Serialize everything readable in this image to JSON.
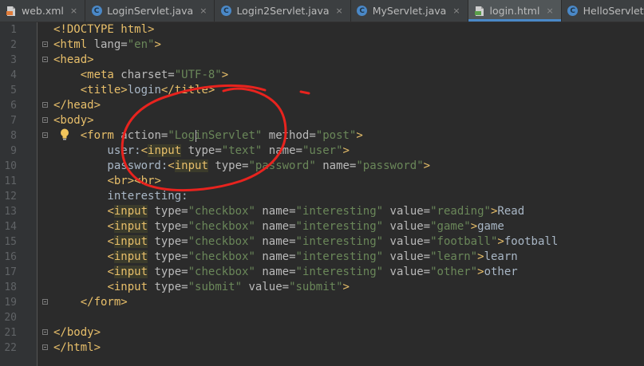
{
  "tabs": [
    {
      "label": "web.xml",
      "icon": "xml-file-icon",
      "active": false
    },
    {
      "label": "LoginServlet.java",
      "icon": "java-class-icon",
      "active": false
    },
    {
      "label": "Login2Servlet.java",
      "icon": "java-class-icon",
      "active": false
    },
    {
      "label": "MyServlet.java",
      "icon": "java-class-icon",
      "active": false
    },
    {
      "label": "login.html",
      "icon": "html-file-icon",
      "active": true
    },
    {
      "label": "HelloServlet.java",
      "icon": "java-class-icon",
      "active": false
    }
  ],
  "editor": {
    "line_numbers": [
      "1",
      "2",
      "3",
      "4",
      "5",
      "6",
      "7",
      "8",
      "9",
      "10",
      "11",
      "12",
      "13",
      "14",
      "15",
      "16",
      "17",
      "18",
      "19",
      "20",
      "21",
      "22"
    ],
    "lines": [
      [
        {
          "c": "t",
          "v": "<!DOCTYPE html>"
        }
      ],
      [
        {
          "c": "t",
          "v": "<html "
        },
        {
          "c": "a",
          "v": "lang="
        },
        {
          "c": "s",
          "v": "\"en\""
        },
        {
          "c": "t",
          "v": ">"
        }
      ],
      [
        {
          "c": "t",
          "v": "<head>"
        }
      ],
      [
        {
          "c": "p",
          "v": "    "
        },
        {
          "c": "t",
          "v": "<meta "
        },
        {
          "c": "a",
          "v": "charset="
        },
        {
          "c": "s",
          "v": "\"UTF-8\""
        },
        {
          "c": "t",
          "v": ">"
        }
      ],
      [
        {
          "c": "p",
          "v": "    "
        },
        {
          "c": "t",
          "v": "<title>"
        },
        {
          "c": "p",
          "v": "login"
        },
        {
          "c": "t",
          "v": "</title>"
        }
      ],
      [
        {
          "c": "t",
          "v": "</head>"
        }
      ],
      [
        {
          "c": "t",
          "v": "<body>"
        }
      ],
      [
        {
          "c": "p",
          "v": "    "
        },
        {
          "c": "t",
          "v": "<form "
        },
        {
          "c": "a",
          "v": "action="
        },
        {
          "c": "s",
          "v": "\"LoginServlet\""
        },
        {
          "c": "p",
          "v": " "
        },
        {
          "c": "a",
          "v": "method="
        },
        {
          "c": "s",
          "v": "\"post\""
        },
        {
          "c": "t",
          "v": ">"
        }
      ],
      [
        {
          "c": "p",
          "v": "        user:"
        },
        {
          "c": "t",
          "v": "<"
        },
        {
          "c": "th",
          "v": "input"
        },
        {
          "c": "t",
          "v": " "
        },
        {
          "c": "a",
          "v": "type="
        },
        {
          "c": "s",
          "v": "\"text\""
        },
        {
          "c": "p",
          "v": " "
        },
        {
          "c": "a",
          "v": "name="
        },
        {
          "c": "s",
          "v": "\"user\""
        },
        {
          "c": "t",
          "v": ">"
        }
      ],
      [
        {
          "c": "p",
          "v": "        password:"
        },
        {
          "c": "t",
          "v": "<"
        },
        {
          "c": "th",
          "v": "input"
        },
        {
          "c": "t",
          "v": " "
        },
        {
          "c": "a",
          "v": "type="
        },
        {
          "c": "s",
          "v": "\"password\""
        },
        {
          "c": "p",
          "v": " "
        },
        {
          "c": "a",
          "v": "name="
        },
        {
          "c": "s",
          "v": "\"password\""
        },
        {
          "c": "t",
          "v": ">"
        }
      ],
      [
        {
          "c": "p",
          "v": "        "
        },
        {
          "c": "t",
          "v": "<br><br>"
        }
      ],
      [
        {
          "c": "p",
          "v": "        interesting:"
        }
      ],
      [
        {
          "c": "p",
          "v": "        "
        },
        {
          "c": "t",
          "v": "<"
        },
        {
          "c": "th",
          "v": "input"
        },
        {
          "c": "t",
          "v": " "
        },
        {
          "c": "a",
          "v": "type="
        },
        {
          "c": "s",
          "v": "\"checkbox\""
        },
        {
          "c": "p",
          "v": " "
        },
        {
          "c": "a",
          "v": "name="
        },
        {
          "c": "s",
          "v": "\"interesting\""
        },
        {
          "c": "p",
          "v": " "
        },
        {
          "c": "a",
          "v": "value="
        },
        {
          "c": "s",
          "v": "\"reading\""
        },
        {
          "c": "t",
          "v": ">"
        },
        {
          "c": "p",
          "v": "Read"
        }
      ],
      [
        {
          "c": "p",
          "v": "        "
        },
        {
          "c": "t",
          "v": "<"
        },
        {
          "c": "th",
          "v": "input"
        },
        {
          "c": "t",
          "v": " "
        },
        {
          "c": "a",
          "v": "type="
        },
        {
          "c": "s",
          "v": "\"checkbox\""
        },
        {
          "c": "p",
          "v": " "
        },
        {
          "c": "a",
          "v": "name="
        },
        {
          "c": "s",
          "v": "\"interesting\""
        },
        {
          "c": "p",
          "v": " "
        },
        {
          "c": "a",
          "v": "value="
        },
        {
          "c": "s",
          "v": "\"game\""
        },
        {
          "c": "t",
          "v": ">"
        },
        {
          "c": "p",
          "v": "game"
        }
      ],
      [
        {
          "c": "p",
          "v": "        "
        },
        {
          "c": "t",
          "v": "<"
        },
        {
          "c": "th",
          "v": "input"
        },
        {
          "c": "t",
          "v": " "
        },
        {
          "c": "a",
          "v": "type="
        },
        {
          "c": "s",
          "v": "\"checkbox\""
        },
        {
          "c": "p",
          "v": " "
        },
        {
          "c": "a",
          "v": "name="
        },
        {
          "c": "s",
          "v": "\"interesting\""
        },
        {
          "c": "p",
          "v": " "
        },
        {
          "c": "a",
          "v": "value="
        },
        {
          "c": "s",
          "v": "\"football\""
        },
        {
          "c": "t",
          "v": ">"
        },
        {
          "c": "p",
          "v": "football"
        }
      ],
      [
        {
          "c": "p",
          "v": "        "
        },
        {
          "c": "t",
          "v": "<"
        },
        {
          "c": "th",
          "v": "input"
        },
        {
          "c": "t",
          "v": " "
        },
        {
          "c": "a",
          "v": "type="
        },
        {
          "c": "s",
          "v": "\"checkbox\""
        },
        {
          "c": "p",
          "v": " "
        },
        {
          "c": "a",
          "v": "name="
        },
        {
          "c": "s",
          "v": "\"interesting\""
        },
        {
          "c": "p",
          "v": " "
        },
        {
          "c": "a",
          "v": "value="
        },
        {
          "c": "s",
          "v": "\"learn\""
        },
        {
          "c": "t",
          "v": ">"
        },
        {
          "c": "p",
          "v": "learn"
        }
      ],
      [
        {
          "c": "p",
          "v": "        "
        },
        {
          "c": "t",
          "v": "<"
        },
        {
          "c": "th",
          "v": "input"
        },
        {
          "c": "t",
          "v": " "
        },
        {
          "c": "a",
          "v": "type="
        },
        {
          "c": "s",
          "v": "\"checkbox\""
        },
        {
          "c": "p",
          "v": " "
        },
        {
          "c": "a",
          "v": "name="
        },
        {
          "c": "s",
          "v": "\"interesting\""
        },
        {
          "c": "p",
          "v": " "
        },
        {
          "c": "a",
          "v": "value="
        },
        {
          "c": "s",
          "v": "\"other\""
        },
        {
          "c": "t",
          "v": ">"
        },
        {
          "c": "p",
          "v": "other"
        }
      ],
      [
        {
          "c": "p",
          "v": "        "
        },
        {
          "c": "t",
          "v": "<input "
        },
        {
          "c": "a",
          "v": "type="
        },
        {
          "c": "s",
          "v": "\"submit\""
        },
        {
          "c": "p",
          "v": " "
        },
        {
          "c": "a",
          "v": "value="
        },
        {
          "c": "s",
          "v": "\"submit\""
        },
        {
          "c": "t",
          "v": ">"
        }
      ],
      [
        {
          "c": "p",
          "v": "    "
        },
        {
          "c": "t",
          "v": "</form>"
        }
      ],
      [],
      [
        {
          "c": "t",
          "v": "</body>"
        }
      ],
      [
        {
          "c": "t",
          "v": "</html>"
        }
      ]
    ],
    "fold_markers": [
      2,
      3,
      6,
      7,
      8,
      19,
      21,
      22
    ]
  },
  "colors": {
    "background": "#2b2b2b",
    "gutter": "#313335",
    "tag": "#e8bf6a",
    "attribute": "#bababa",
    "string": "#6a8759",
    "plain": "#a9b7c6",
    "annotation": "#e8231e",
    "active_tab_accent": "#4a88c7"
  }
}
